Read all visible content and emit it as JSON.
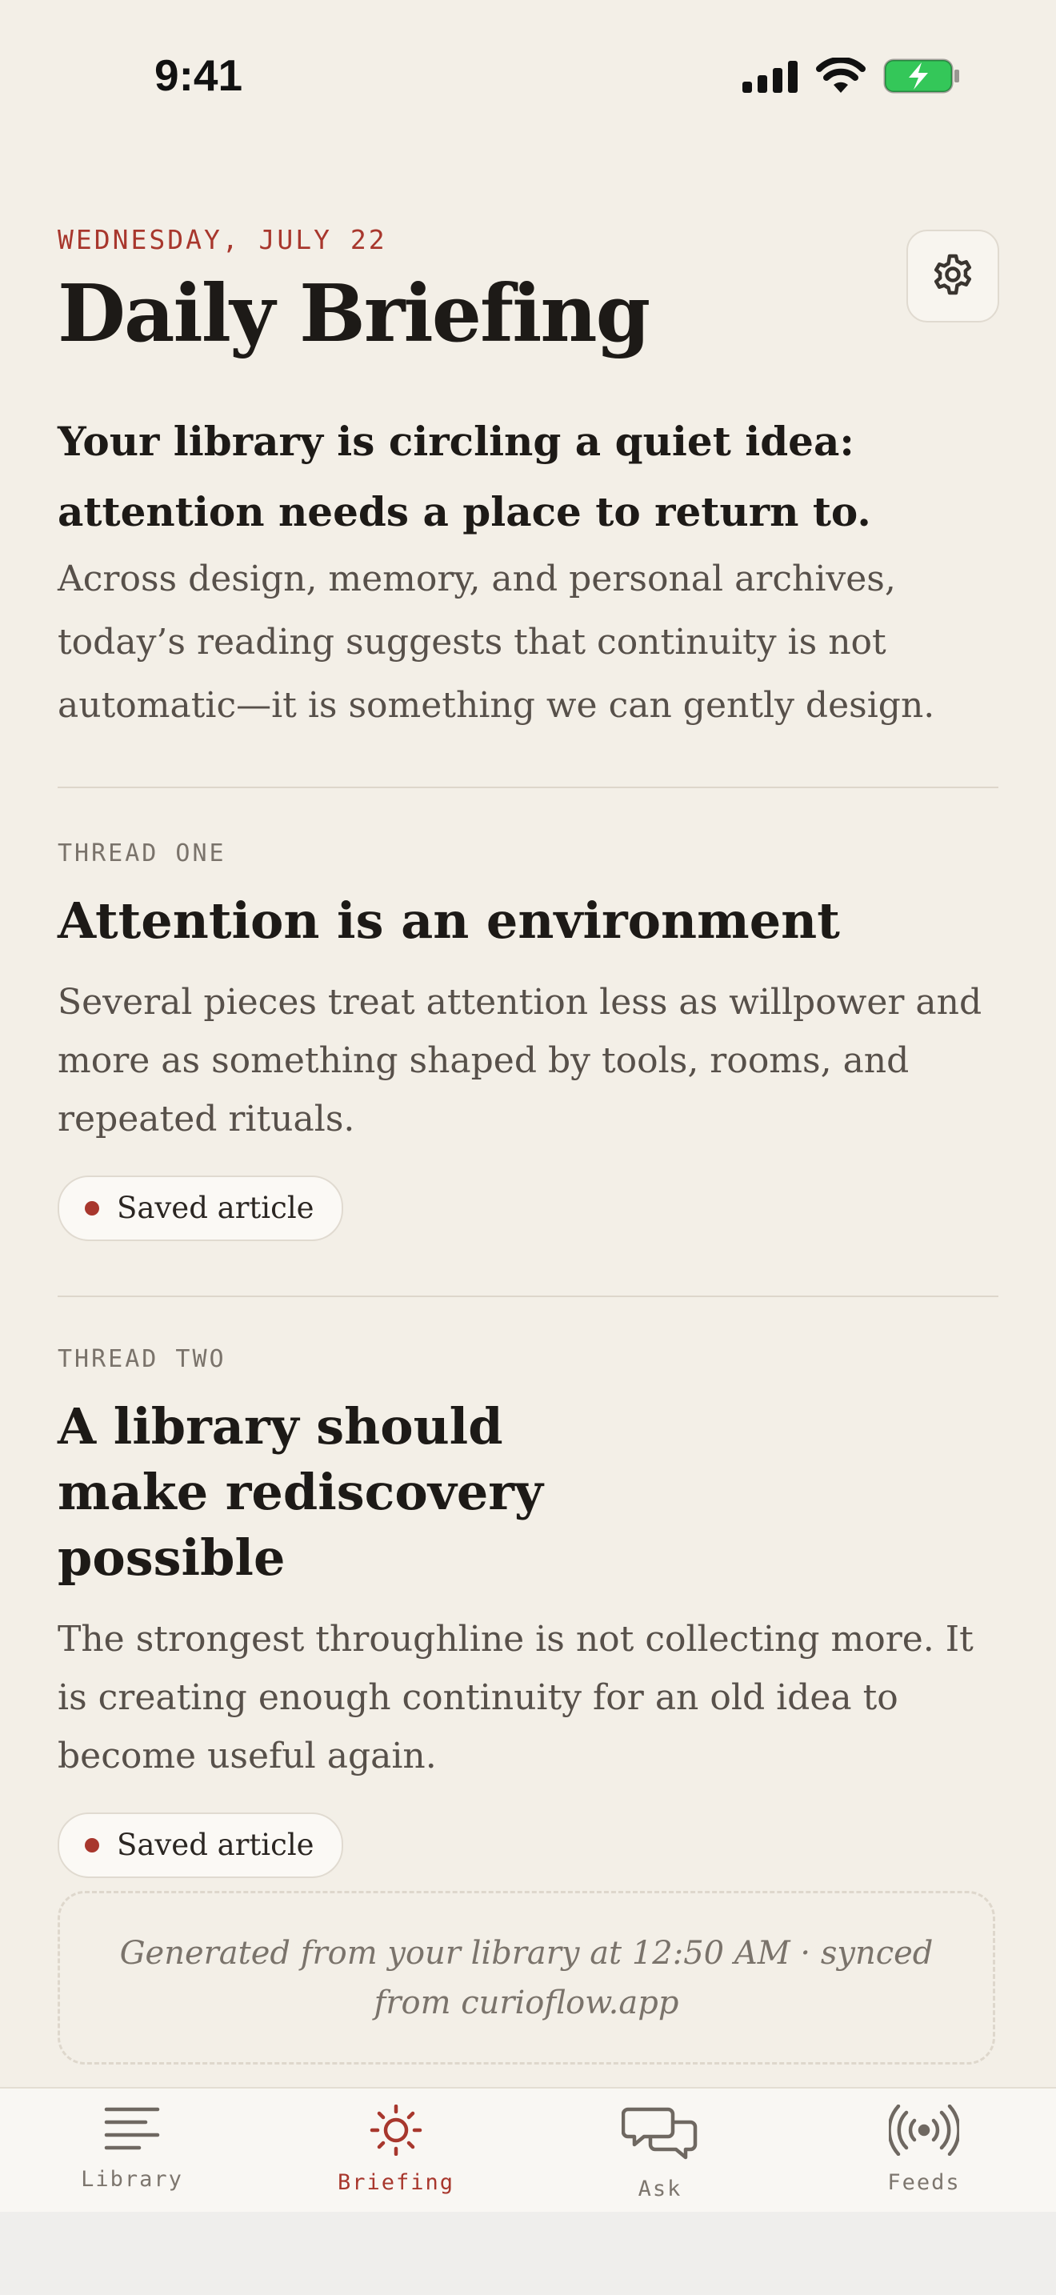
{
  "status_bar": {
    "time": "9:41",
    "icons": [
      "cellular-signal-icon",
      "wifi-icon",
      "battery-charging-icon"
    ],
    "battery_color": "#34c759"
  },
  "header": {
    "date": "WEDNESDAY, JULY 22",
    "title": "Daily Briefing",
    "settings_icon": "gear-icon"
  },
  "summary": {
    "lead": "Your library is circling a quiet idea: attention needs a place to return to.",
    "body": "Across design, memory, and personal archives, today’s reading suggests that continuity is not automatic—it is something we can gently design."
  },
  "threads": [
    {
      "kicker": "THREAD ONE",
      "title": "Attention is an environment",
      "body": "Several pieces treat attention less as willpower and more as something shaped by tools, rooms, and repeated rituals.",
      "chip": "Saved article"
    },
    {
      "kicker": "THREAD TWO",
      "title": "A library should make rediscovery possible",
      "body": "The strongest throughline is not collecting more. It is creating enough continuity for an old idea to become useful again.",
      "chip": "Saved article"
    }
  ],
  "footer_note": "Generated from your library at 12:50 AM · synced from curioflow.app",
  "tabs": [
    {
      "label": "Library",
      "icon": "library-lines-icon",
      "active": false
    },
    {
      "label": "Briefing",
      "icon": "sun-icon",
      "active": true
    },
    {
      "label": "Ask",
      "icon": "chat-bubbles-icon",
      "active": false
    },
    {
      "label": "Feeds",
      "icon": "broadcast-icon",
      "active": false
    }
  ],
  "colors": {
    "accent": "#a8372d",
    "background": "#f3efe7",
    "text": "#1d1a17",
    "muted": "#57504a"
  }
}
